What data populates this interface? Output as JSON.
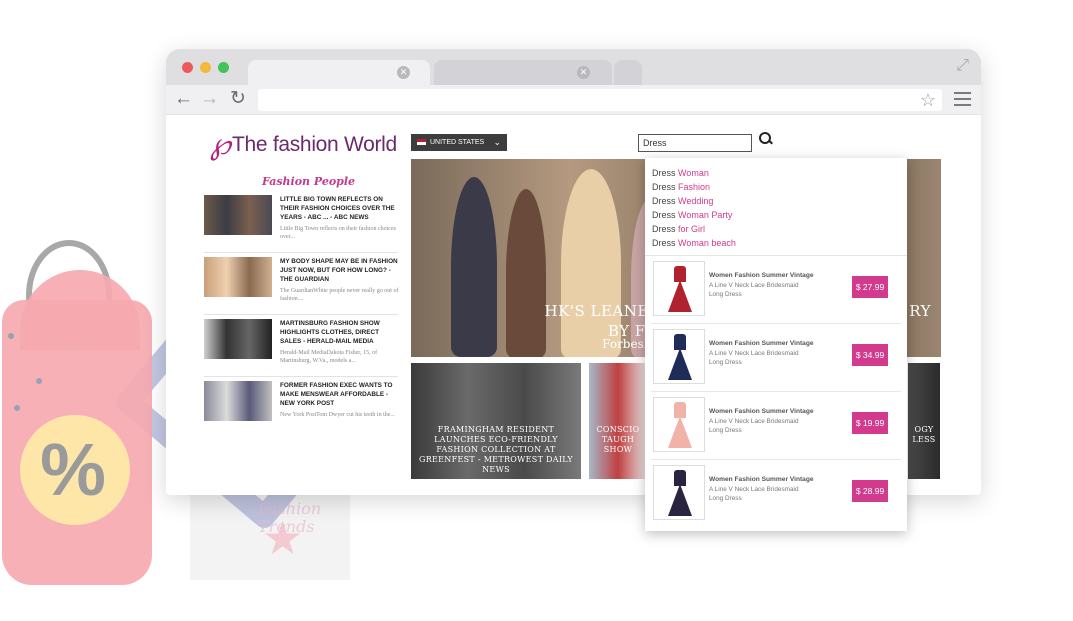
{
  "brand": {
    "logo_text": "The fashion World",
    "logo_mark": "℘",
    "accent": "#d23a8e",
    "dark": "#6b2a6b"
  },
  "country_select": {
    "value": "UNITED STATES"
  },
  "search": {
    "value": "Dress"
  },
  "sidebar": {
    "title": "Fashion People",
    "items": [
      {
        "headline": "LITTLE BIG TOWN REFLECTS ON THEIR FASHION CHOICES OVER THE YEARS - ABC ... - ABC NEWS",
        "summary": "Little Big Town reflects on their fashion choices over..."
      },
      {
        "headline": "MY BODY SHAPE MAY BE IN FASHION JUST NOW, BUT FOR HOW LONG? - THE GUARDIAN",
        "summary": "The GuardianWhite people never really go out of fashion...."
      },
      {
        "headline": "MARTINSBURG FASHION SHOW HIGHLIGHTS CLOTHES, DIRECT SALES - HERALD-MAIL MEDIA",
        "summary": "Herald-Mail MediaDakota Fisher, 15, of Martinsburg, W.Va., models a..."
      },
      {
        "headline": "FORMER FASHION EXEC WANTS TO MAKE MENSWEAR AFFORDABLE - NEW YORK POST",
        "summary": "New York PostTom Dwyer cut his teeth in the..."
      }
    ]
  },
  "hero": {
    "title_line1": "HK'S LEANEST STARTUP GRAN",
    "title_right": "RY",
    "title_line2": "BY FOCUSING C",
    "subtitle": "ForbesIt's not often that"
  },
  "cards": [
    {
      "title": "FRAMINGHAM RESIDENT LAUNCHES ECO-FRIENDLY FASHION COLLECTION AT GREENFEST - METROWEST DAILY NEWS"
    },
    {
      "title": "CONSCIO TAUGH SHOW"
    },
    {
      "title": "OGY LESS"
    }
  ],
  "suggestions": [
    {
      "prefix": "Dress",
      "term": "Woman"
    },
    {
      "prefix": "Dress",
      "term": "Fashion"
    },
    {
      "prefix": "Dress",
      "term": "Wedding"
    },
    {
      "prefix": "Dress",
      "term": "Woman Party"
    },
    {
      "prefix": "Dress",
      "term": "for Girl"
    },
    {
      "prefix": "Dress",
      "term": "Woman beach"
    }
  ],
  "products": [
    {
      "name": "Women Fashion Summer Vintage",
      "desc1": "A Line V Neck Lace Bridesmaid",
      "desc2": "Long Dress",
      "price": "$ 27.99",
      "dress_color": "#b0222e"
    },
    {
      "name": "Women Fashion Summer Vintage",
      "desc1": "A Line V Neck Lace Bridesmaid",
      "desc2": "Long Dress",
      "price": "$ 34.99",
      "dress_color": "#1e2c57"
    },
    {
      "name": "Women Fashion Summer Vintage",
      "desc1": "A Line V Neck Lace Bridesmaid",
      "desc2": "Long Dress",
      "price": "$ 19.99",
      "dress_color": "#f1b3a8"
    },
    {
      "name": "Women Fashion Summer Vintage",
      "desc1": "A Line V Neck Lace Bridesmaid",
      "desc2": "Long Dress",
      "price": "$ 28.99",
      "dress_color": "#2a2440"
    }
  ],
  "decor": {
    "tag_symbol": "%",
    "ghost_text": "Fashion Trends"
  }
}
